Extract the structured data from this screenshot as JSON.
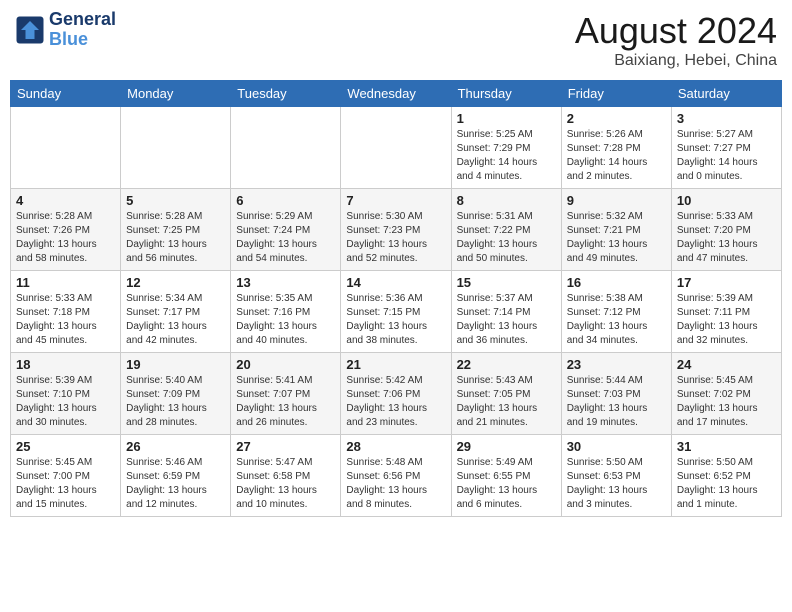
{
  "header": {
    "logo_line1": "General",
    "logo_line2": "Blue",
    "month": "August 2024",
    "location": "Baixiang, Hebei, China"
  },
  "days_of_week": [
    "Sunday",
    "Monday",
    "Tuesday",
    "Wednesday",
    "Thursday",
    "Friday",
    "Saturday"
  ],
  "weeks": [
    [
      {
        "day": "",
        "info": ""
      },
      {
        "day": "",
        "info": ""
      },
      {
        "day": "",
        "info": ""
      },
      {
        "day": "",
        "info": ""
      },
      {
        "day": "1",
        "info": "Sunrise: 5:25 AM\nSunset: 7:29 PM\nDaylight: 14 hours\nand 4 minutes."
      },
      {
        "day": "2",
        "info": "Sunrise: 5:26 AM\nSunset: 7:28 PM\nDaylight: 14 hours\nand 2 minutes."
      },
      {
        "day": "3",
        "info": "Sunrise: 5:27 AM\nSunset: 7:27 PM\nDaylight: 14 hours\nand 0 minutes."
      }
    ],
    [
      {
        "day": "4",
        "info": "Sunrise: 5:28 AM\nSunset: 7:26 PM\nDaylight: 13 hours\nand 58 minutes."
      },
      {
        "day": "5",
        "info": "Sunrise: 5:28 AM\nSunset: 7:25 PM\nDaylight: 13 hours\nand 56 minutes."
      },
      {
        "day": "6",
        "info": "Sunrise: 5:29 AM\nSunset: 7:24 PM\nDaylight: 13 hours\nand 54 minutes."
      },
      {
        "day": "7",
        "info": "Sunrise: 5:30 AM\nSunset: 7:23 PM\nDaylight: 13 hours\nand 52 minutes."
      },
      {
        "day": "8",
        "info": "Sunrise: 5:31 AM\nSunset: 7:22 PM\nDaylight: 13 hours\nand 50 minutes."
      },
      {
        "day": "9",
        "info": "Sunrise: 5:32 AM\nSunset: 7:21 PM\nDaylight: 13 hours\nand 49 minutes."
      },
      {
        "day": "10",
        "info": "Sunrise: 5:33 AM\nSunset: 7:20 PM\nDaylight: 13 hours\nand 47 minutes."
      }
    ],
    [
      {
        "day": "11",
        "info": "Sunrise: 5:33 AM\nSunset: 7:18 PM\nDaylight: 13 hours\nand 45 minutes."
      },
      {
        "day": "12",
        "info": "Sunrise: 5:34 AM\nSunset: 7:17 PM\nDaylight: 13 hours\nand 42 minutes."
      },
      {
        "day": "13",
        "info": "Sunrise: 5:35 AM\nSunset: 7:16 PM\nDaylight: 13 hours\nand 40 minutes."
      },
      {
        "day": "14",
        "info": "Sunrise: 5:36 AM\nSunset: 7:15 PM\nDaylight: 13 hours\nand 38 minutes."
      },
      {
        "day": "15",
        "info": "Sunrise: 5:37 AM\nSunset: 7:14 PM\nDaylight: 13 hours\nand 36 minutes."
      },
      {
        "day": "16",
        "info": "Sunrise: 5:38 AM\nSunset: 7:12 PM\nDaylight: 13 hours\nand 34 minutes."
      },
      {
        "day": "17",
        "info": "Sunrise: 5:39 AM\nSunset: 7:11 PM\nDaylight: 13 hours\nand 32 minutes."
      }
    ],
    [
      {
        "day": "18",
        "info": "Sunrise: 5:39 AM\nSunset: 7:10 PM\nDaylight: 13 hours\nand 30 minutes."
      },
      {
        "day": "19",
        "info": "Sunrise: 5:40 AM\nSunset: 7:09 PM\nDaylight: 13 hours\nand 28 minutes."
      },
      {
        "day": "20",
        "info": "Sunrise: 5:41 AM\nSunset: 7:07 PM\nDaylight: 13 hours\nand 26 minutes."
      },
      {
        "day": "21",
        "info": "Sunrise: 5:42 AM\nSunset: 7:06 PM\nDaylight: 13 hours\nand 23 minutes."
      },
      {
        "day": "22",
        "info": "Sunrise: 5:43 AM\nSunset: 7:05 PM\nDaylight: 13 hours\nand 21 minutes."
      },
      {
        "day": "23",
        "info": "Sunrise: 5:44 AM\nSunset: 7:03 PM\nDaylight: 13 hours\nand 19 minutes."
      },
      {
        "day": "24",
        "info": "Sunrise: 5:45 AM\nSunset: 7:02 PM\nDaylight: 13 hours\nand 17 minutes."
      }
    ],
    [
      {
        "day": "25",
        "info": "Sunrise: 5:45 AM\nSunset: 7:00 PM\nDaylight: 13 hours\nand 15 minutes."
      },
      {
        "day": "26",
        "info": "Sunrise: 5:46 AM\nSunset: 6:59 PM\nDaylight: 13 hours\nand 12 minutes."
      },
      {
        "day": "27",
        "info": "Sunrise: 5:47 AM\nSunset: 6:58 PM\nDaylight: 13 hours\nand 10 minutes."
      },
      {
        "day": "28",
        "info": "Sunrise: 5:48 AM\nSunset: 6:56 PM\nDaylight: 13 hours\nand 8 minutes."
      },
      {
        "day": "29",
        "info": "Sunrise: 5:49 AM\nSunset: 6:55 PM\nDaylight: 13 hours\nand 6 minutes."
      },
      {
        "day": "30",
        "info": "Sunrise: 5:50 AM\nSunset: 6:53 PM\nDaylight: 13 hours\nand 3 minutes."
      },
      {
        "day": "31",
        "info": "Sunrise: 5:50 AM\nSunset: 6:52 PM\nDaylight: 13 hours\nand 1 minute."
      }
    ]
  ]
}
